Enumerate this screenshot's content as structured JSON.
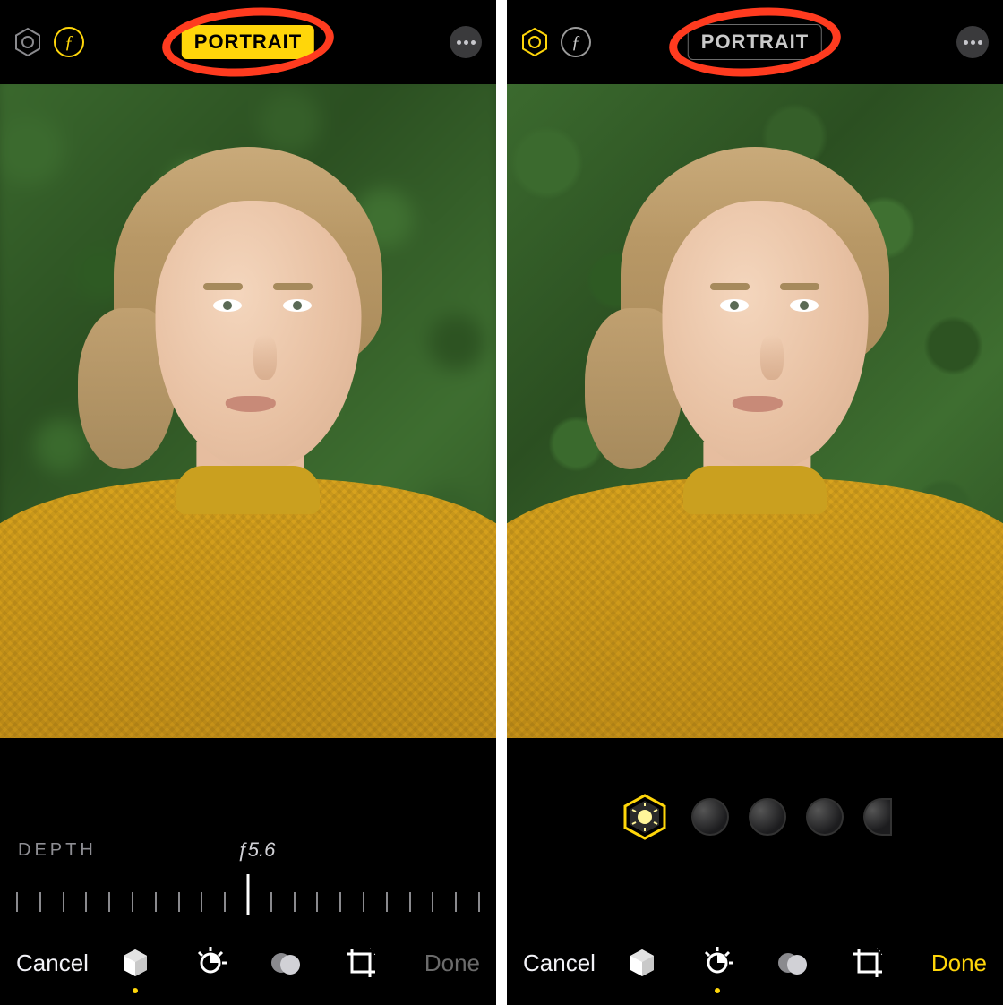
{
  "screens": [
    {
      "top": {
        "lighting_active": false,
        "f_active": true,
        "portrait_label": "PORTRAIT",
        "portrait_active": true
      },
      "photo": {
        "background_blurred": true
      },
      "controls": {
        "mode": "depth",
        "depth_label": "DEPTH",
        "depth_value": "ƒ5.6",
        "slider_ticks": 21
      },
      "bottom": {
        "cancel": "Cancel",
        "done": "Done",
        "done_enabled": false,
        "selected_tool": 0
      }
    },
    {
      "top": {
        "lighting_active": true,
        "f_active": false,
        "portrait_label": "PORTRAIT",
        "portrait_active": false
      },
      "photo": {
        "background_blurred": false
      },
      "controls": {
        "mode": "lighting",
        "lighting_options": 5
      },
      "bottom": {
        "cancel": "Cancel",
        "done": "Done",
        "done_enabled": true,
        "selected_tool": 1
      }
    }
  ],
  "tools": [
    "portrait-lighting",
    "adjust",
    "filters",
    "crop"
  ],
  "annotation": {
    "shape": "oval-circle",
    "color": "#ff3b1f"
  }
}
